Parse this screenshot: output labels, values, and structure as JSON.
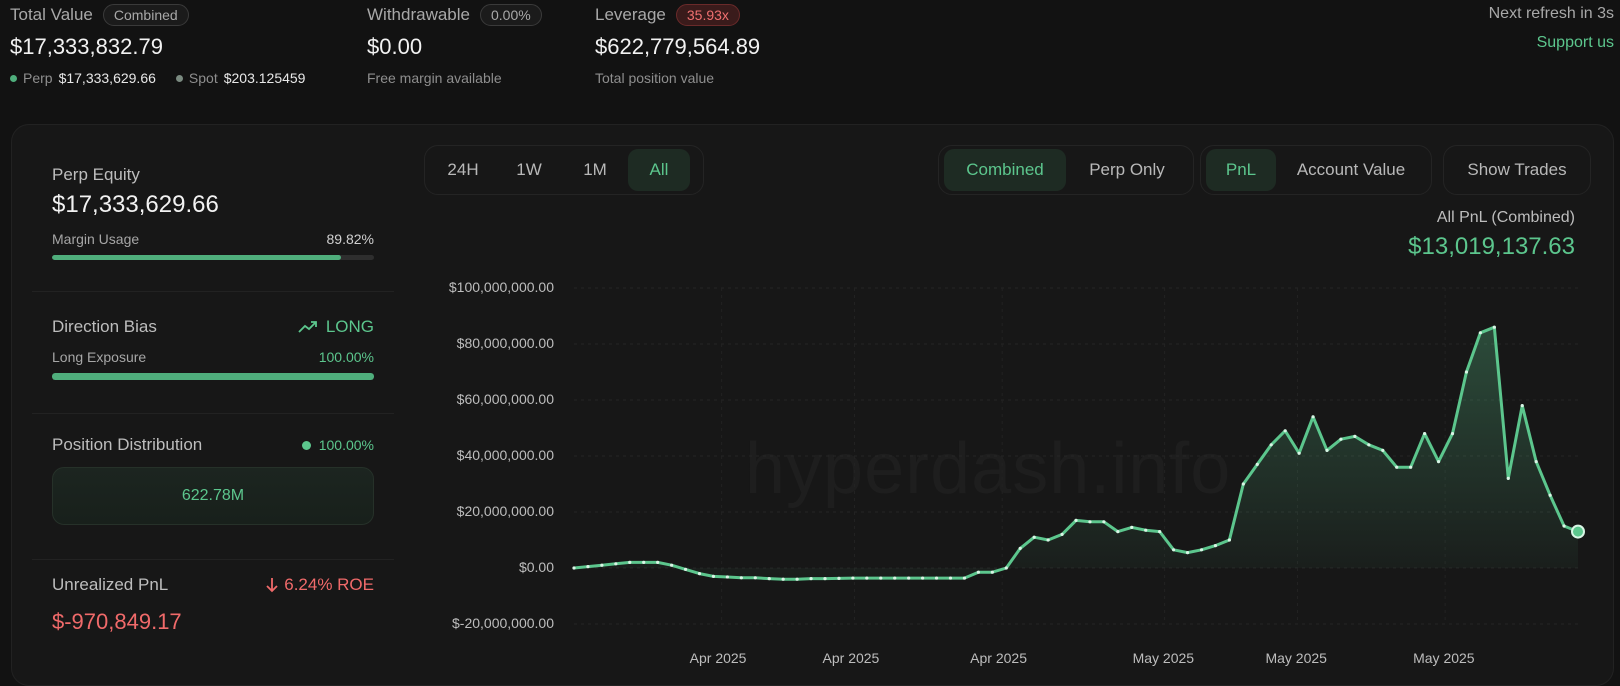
{
  "header": {
    "total_value_label": "Total Value",
    "total_value_badge": "Combined",
    "total_value": "$17,333,832.79",
    "perp_label": "Perp",
    "perp_value": "$17,333,629.66",
    "spot_label": "Spot",
    "spot_value": "$203.125459",
    "withdrawable_label": "Withdrawable",
    "withdrawable_badge": "0.00%",
    "withdrawable_value": "$0.00",
    "withdrawable_sub": "Free margin available",
    "leverage_label": "Leverage",
    "leverage_badge": "35.93x",
    "leverage_value": "$622,779,564.89",
    "leverage_sub": "Total position value",
    "refresh_text": "Next refresh in 3s",
    "support_link": "Support us"
  },
  "sidebar": {
    "perp_equity_label": "Perp Equity",
    "perp_equity_value": "$17,333,629.66",
    "margin_usage_label": "Margin Usage",
    "margin_usage_value": "89.82%",
    "margin_usage_fraction": 0.8982,
    "direction_bias_label": "Direction Bias",
    "direction_bias_value": "LONG",
    "long_exposure_label": "Long Exposure",
    "long_exposure_value": "100.00%",
    "long_exposure_fraction": 1.0,
    "position_distribution_label": "Position Distribution",
    "position_distribution_value": "100.00%",
    "position_distribution_box": "622.78M",
    "unrealized_pnl_label": "Unrealized PnL",
    "unrealized_roe": "6.24% ROE",
    "unrealized_pnl_value": "$-970,849.17"
  },
  "controls": {
    "range_tabs": [
      "24H",
      "1W",
      "1M",
      "All"
    ],
    "range_active": "All",
    "mode_tabs": [
      "Combined",
      "Perp Only"
    ],
    "mode_active": "Combined",
    "metric_tabs": [
      "PnL",
      "Account Value"
    ],
    "metric_active": "PnL",
    "show_trades": "Show Trades"
  },
  "pnl_summary": {
    "label": "All PnL (Combined)",
    "value": "$13,019,137.63"
  },
  "watermark": "hyperdash.info",
  "colors": {
    "accent": "#5cc68d",
    "negative": "#f06a6a",
    "background": "#121212"
  },
  "chart_data": {
    "type": "area",
    "y_tick_labels": [
      "$100,000,000.00",
      "$80,000,000.00",
      "$60,000,000.00",
      "$40,000,000.00",
      "$20,000,000.00",
      "$0.00",
      "$-20,000,000.00"
    ],
    "y_ticks": [
      100000000,
      80000000,
      60000000,
      40000000,
      20000000,
      0,
      -20000000
    ],
    "ylim": [
      -20000000,
      100000000
    ],
    "x_tick_labels": [
      "Apr 2025",
      "Apr 2025",
      "Apr 2025",
      "May 2025",
      "May 2025",
      "May 2025"
    ],
    "x_tick_index": [
      10,
      19,
      29,
      40,
      49,
      59
    ],
    "x_count": 69,
    "grid": true,
    "values": [
      0,
      500000,
      1000000,
      1500000,
      2000000,
      2000000,
      2000000,
      1000000,
      -500000,
      -2000000,
      -3000000,
      -3200000,
      -3500000,
      -3500000,
      -3800000,
      -4000000,
      -4000000,
      -3800000,
      -3800000,
      -3700000,
      -3600000,
      -3600000,
      -3600000,
      -3600000,
      -3600000,
      -3600000,
      -3600000,
      -3600000,
      -3600000,
      -1500000,
      -1500000,
      0,
      7000000,
      11000000,
      10000000,
      12000000,
      17000000,
      16500000,
      16500000,
      13000000,
      14500000,
      13500000,
      13000000,
      6500000,
      5500000,
      6500000,
      8000000,
      10000000,
      30000000,
      37000000,
      44000000,
      49000000,
      41000000,
      54000000,
      42000000,
      46000000,
      47000000,
      44000000,
      42000000,
      36000000,
      36000000,
      48000000,
      38000000,
      48000000,
      70000000,
      84000000,
      86000000,
      32000000,
      58000000
    ],
    "values_tail": [
      38000000,
      26000000,
      15000000,
      13000000
    ]
  }
}
